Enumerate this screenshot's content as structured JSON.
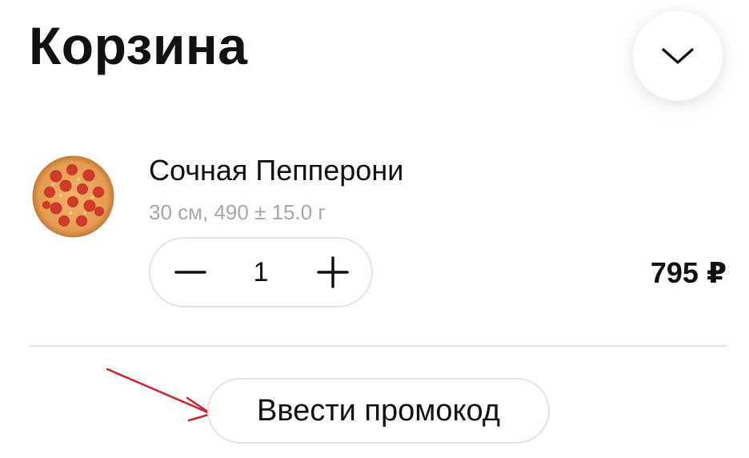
{
  "header": {
    "title": "Корзина",
    "collapse_icon": "chevron-down-icon"
  },
  "cart": {
    "items": [
      {
        "name": "Сочная Пепперони",
        "details": "30 см, 490 ± 15.0 г",
        "image_icon": "pepperoni-pizza-image",
        "quantity": "1",
        "price": "795 ₽"
      }
    ]
  },
  "stepper": {
    "minus_icon": "minus-icon",
    "plus_icon": "plus-icon"
  },
  "promo": {
    "label": "Ввести промокод"
  },
  "annotation": {
    "arrow_color": "#d0202a",
    "arrow_icon": "red-arrow-annotation"
  },
  "colors": {
    "text": "#111111",
    "muted_text": "#a6a6a6",
    "border": "#e3e3e3"
  }
}
